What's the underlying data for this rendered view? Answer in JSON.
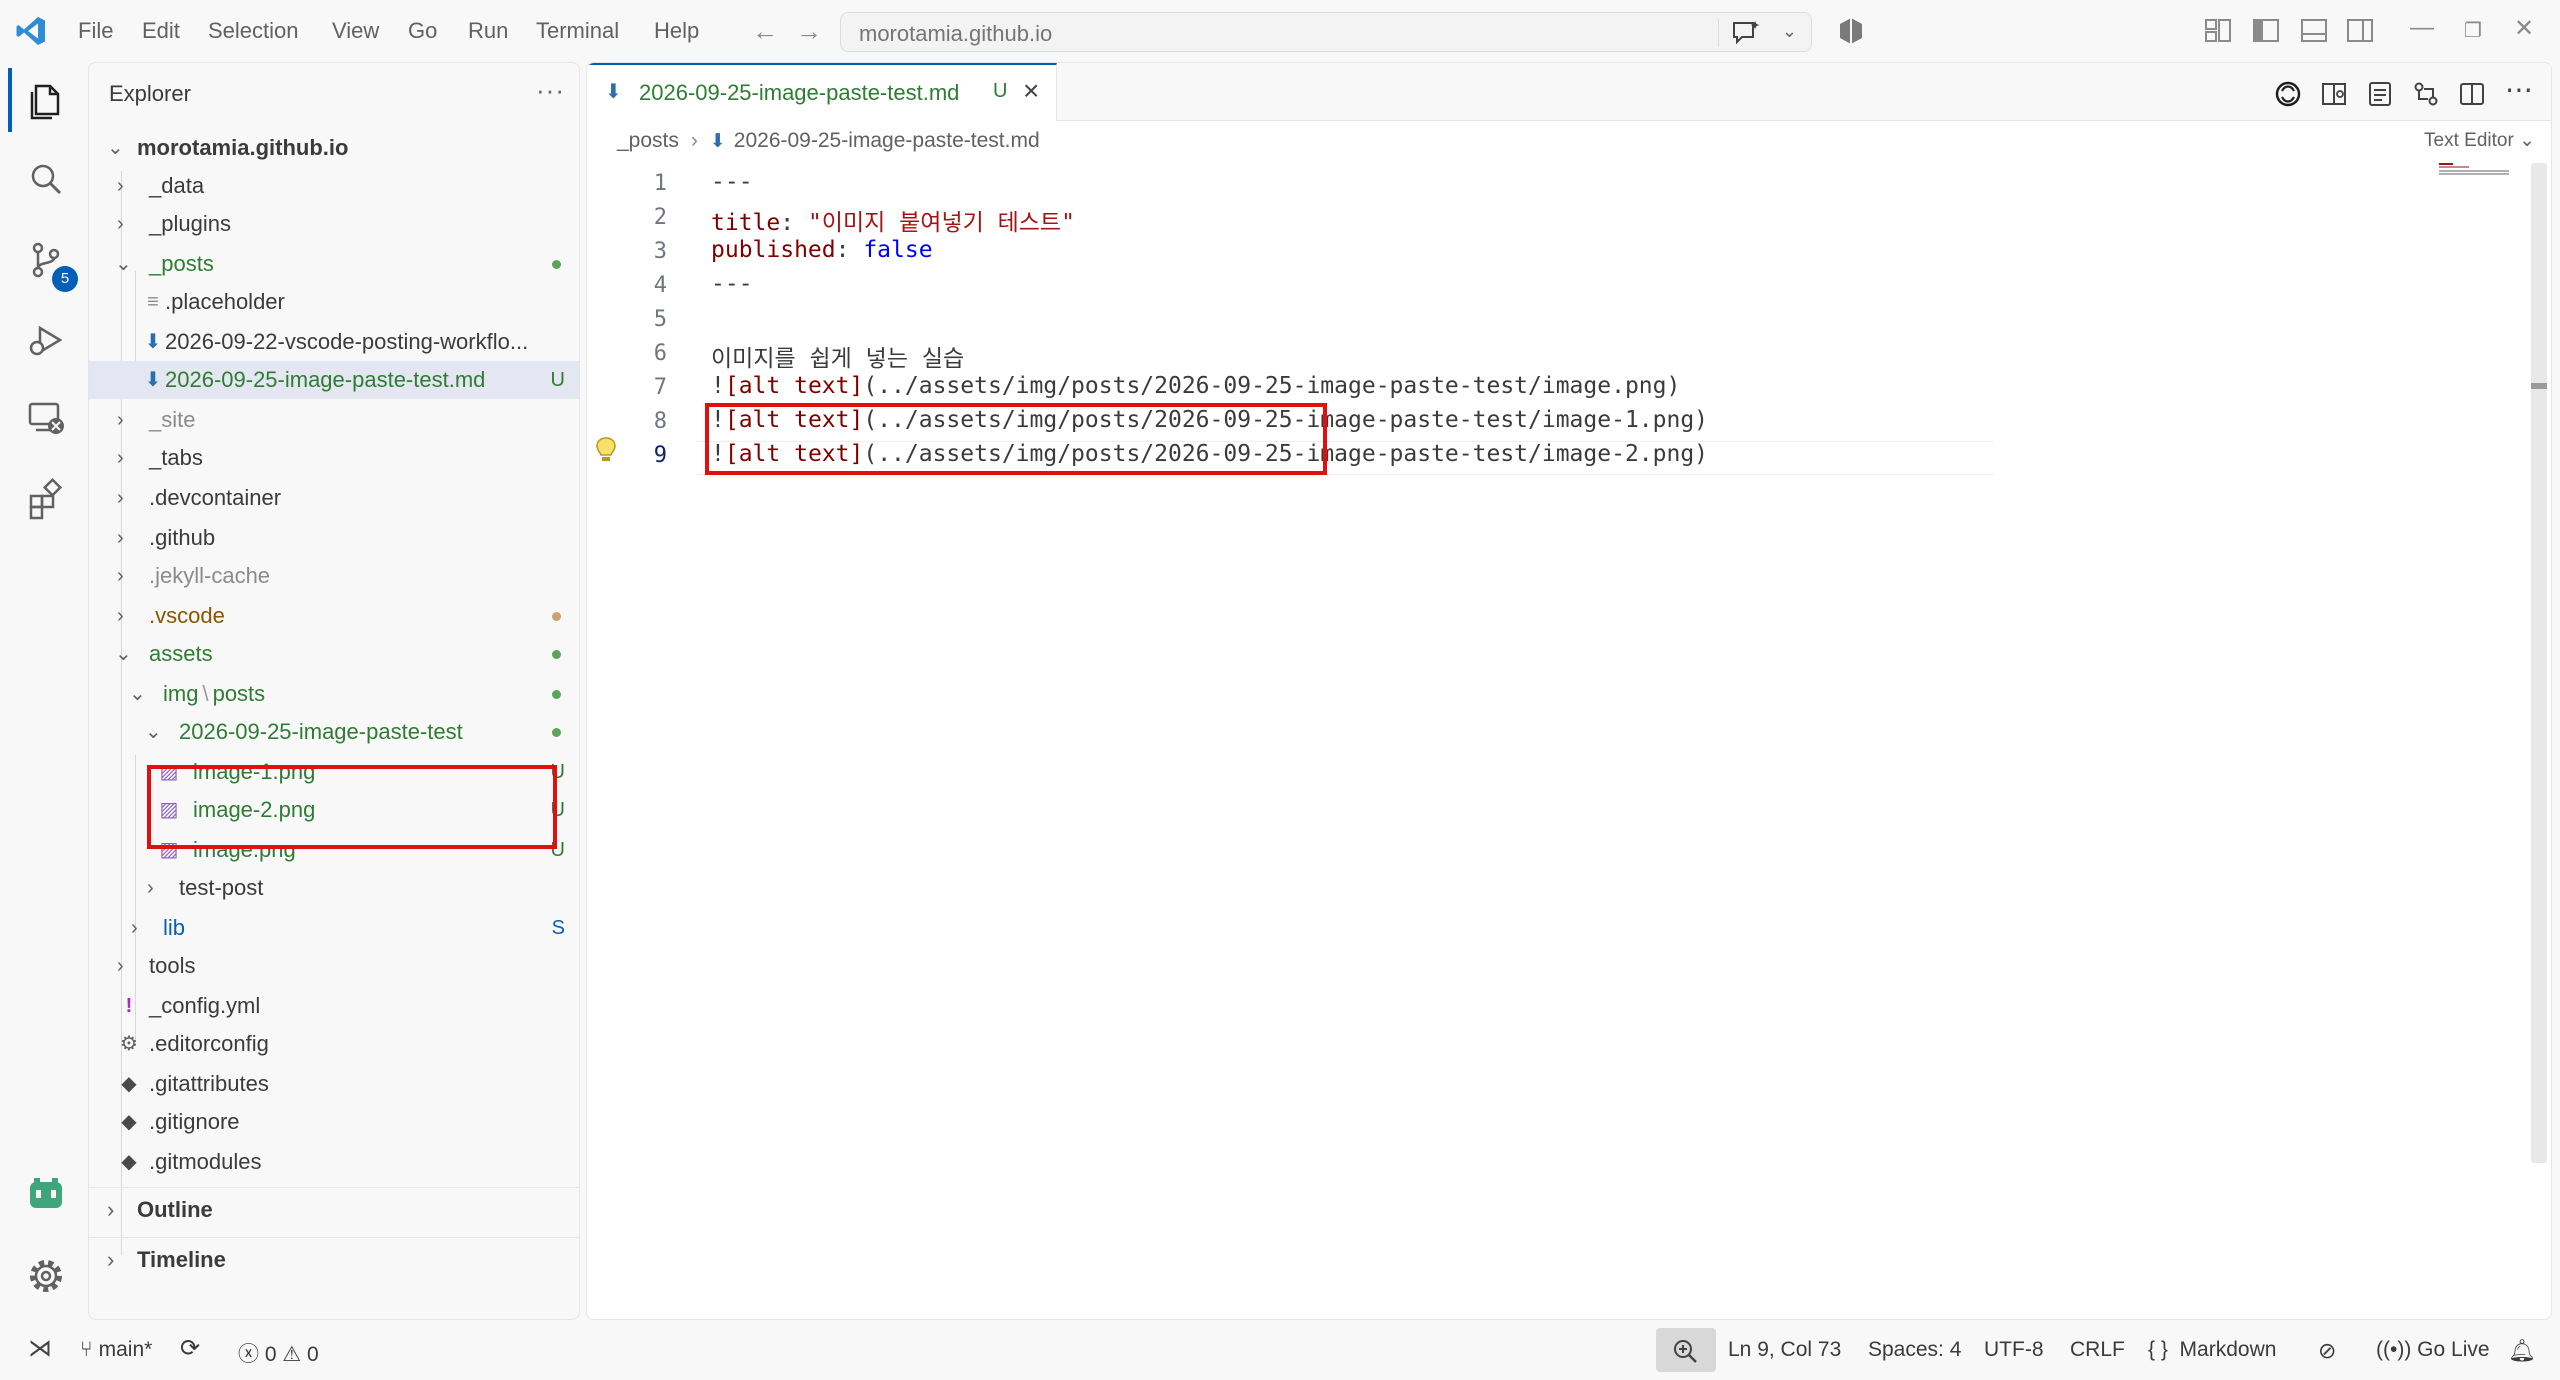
{
  "titlebar": {
    "menu": [
      "File",
      "Edit",
      "Selection",
      "View",
      "Go",
      "Run",
      "Terminal",
      "Help"
    ],
    "command_center": "morotamia.github.io"
  },
  "activity_bar": {
    "items": [
      "explorer-icon",
      "search-icon",
      "source-control-icon",
      "run-debug-icon",
      "remote-explorer-icon",
      "extensions-icon",
      "github-copilot-icon",
      "settings-gear-icon"
    ],
    "source_control_badge": "5"
  },
  "sidebar": {
    "title": "Explorer",
    "more": "···",
    "root": "morotamia.github.io",
    "rows": [
      {
        "label": "_data"
      },
      {
        "label": "_plugins"
      },
      {
        "label": "_posts"
      },
      {
        "label": ".placeholder"
      },
      {
        "label": "2026-09-22-vscode-posting-workflo..."
      },
      {
        "label": "2026-09-25-image-paste-test.md",
        "decoration": "U"
      },
      {
        "label": "_site"
      },
      {
        "label": "_tabs"
      },
      {
        "label": ".devcontainer"
      },
      {
        "label": ".github"
      },
      {
        "label": ".jekyll-cache"
      },
      {
        "label": ".vscode"
      },
      {
        "label": "assets"
      },
      {
        "label_a": "img",
        "label_sep": "\\",
        "label_b": "posts"
      },
      {
        "label": "2026-09-25-image-paste-test"
      },
      {
        "label": "image-1.png",
        "decoration": "U"
      },
      {
        "label": "image-2.png",
        "decoration": "U"
      },
      {
        "label": "image.png",
        "decoration": "U"
      },
      {
        "label": "test-post"
      },
      {
        "label": "lib",
        "decoration": "S"
      },
      {
        "label": "tools"
      },
      {
        "label": "_config.yml"
      },
      {
        "label": ".editorconfig"
      },
      {
        "label": ".gitattributes"
      },
      {
        "label": ".gitignore"
      },
      {
        "label": ".gitmodules"
      }
    ],
    "outline": "Outline",
    "timeline": "Timeline"
  },
  "editor": {
    "tab": {
      "label": "2026-09-25-image-paste-test.md",
      "status": "U"
    },
    "breadcrumb": [
      "_posts",
      "2026-09-25-image-paste-test.md"
    ],
    "text_editor_btn": "Text Editor",
    "lines": [
      {
        "n": "1",
        "parts": [
          {
            "t": "---",
            "c": "plain"
          }
        ]
      },
      {
        "n": "2",
        "parts": [
          {
            "t": "title",
            "c": "key"
          },
          {
            "t": ": ",
            "c": "plain"
          },
          {
            "t": "\"이미지 붙여넣기 테스트\"",
            "c": "str"
          }
        ]
      },
      {
        "n": "3",
        "parts": [
          {
            "t": "published",
            "c": "key"
          },
          {
            "t": ": ",
            "c": "plain"
          },
          {
            "t": "false",
            "c": "bool"
          }
        ]
      },
      {
        "n": "4",
        "parts": [
          {
            "t": "---",
            "c": "plain"
          }
        ]
      },
      {
        "n": "5",
        "parts": []
      },
      {
        "n": "6",
        "parts": [
          {
            "t": "이미지를 쉽게 넣는 실습",
            "c": "plain"
          }
        ]
      },
      {
        "n": "7",
        "parts": [
          {
            "t": "!",
            "c": "plain"
          },
          {
            "t": "[alt text]",
            "c": "bracket"
          },
          {
            "t": "(../assets/img/posts/2026-09-25-image-paste-test/image.png)",
            "c": "plain"
          }
        ]
      },
      {
        "n": "8",
        "parts": [
          {
            "t": "!",
            "c": "plain"
          },
          {
            "t": "[alt text]",
            "c": "bracket"
          },
          {
            "t": "(../assets/img/posts/2026-09-25-image-paste-test/image-1.png)",
            "c": "plain"
          }
        ]
      },
      {
        "n": "9",
        "parts": [
          {
            "t": "!",
            "c": "plain"
          },
          {
            "t": "[alt text]",
            "c": "bracket"
          },
          {
            "t": "(../assets/img/posts/2026-09-25-image-paste-test/image-2.png)",
            "c": "plain"
          }
        ]
      }
    ]
  },
  "statusbar": {
    "branch": "main*",
    "errors": "0",
    "warnings": "0",
    "position": "Ln 9, Col 73",
    "spaces": "Spaces: 4",
    "encoding": "UTF-8",
    "eol": "CRLF",
    "language_braces": "{ }",
    "language": "Markdown",
    "go_live": "Go Live"
  }
}
